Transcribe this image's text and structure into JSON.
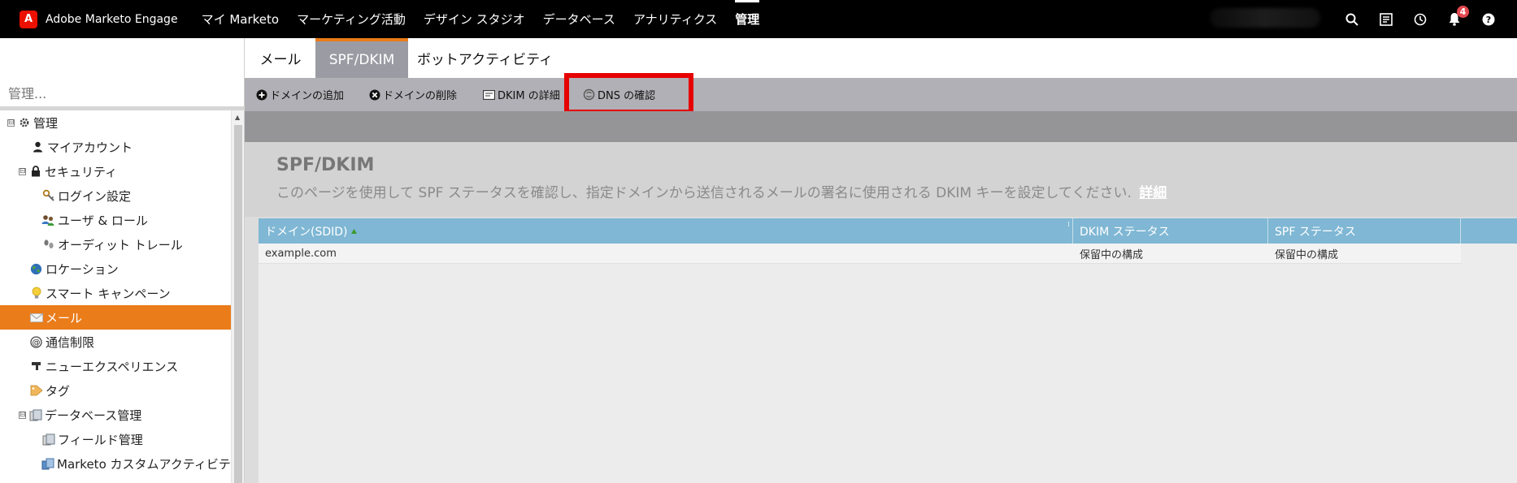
{
  "app": {
    "logo_letter": "A",
    "name": "Adobe Marketo Engage"
  },
  "topnav": {
    "items": [
      {
        "label": "マイ Marketo"
      },
      {
        "label": "マーケティング活動"
      },
      {
        "label": "デザイン スタジオ"
      },
      {
        "label": "データベース"
      },
      {
        "label": "アナリティクス"
      },
      {
        "label": "管理"
      }
    ],
    "notification_count": "4"
  },
  "sidebar": {
    "search_placeholder": "管理...",
    "tree": [
      {
        "label": "管理",
        "expander": "⊟"
      },
      {
        "label": "マイアカウント"
      },
      {
        "label": "セキュリティ",
        "expander": "⊟"
      },
      {
        "label": "ログイン設定"
      },
      {
        "label": "ユーザ & ロール"
      },
      {
        "label": "オーディット トレール"
      },
      {
        "label": "ロケーション"
      },
      {
        "label": "スマート キャンペーン"
      },
      {
        "label": "メール",
        "selected": true
      },
      {
        "label": "通信制限"
      },
      {
        "label": "ニューエクスペリエンス"
      },
      {
        "label": "タグ"
      },
      {
        "label": "データベース管理",
        "expander": "⊟"
      },
      {
        "label": "フィールド管理"
      },
      {
        "label": "Marketo カスタムアクティビティ"
      }
    ]
  },
  "tabs": [
    {
      "label": "メール"
    },
    {
      "label": "SPF/DKIM",
      "active": true
    },
    {
      "label": "ボットアクティビティ"
    }
  ],
  "toolbar": {
    "add_domain": "ドメインの追加",
    "delete_domain": "ドメインの削除",
    "dkim_details": "DKIM の詳細",
    "dns_check": "DNS の確認"
  },
  "page": {
    "title": "SPF/DKIM",
    "description": "このページを使用して SPF ステータスを確認し、指定ドメインから送信されるメールの署名に使用される DKIM キーを設定してください.",
    "link": "詳細"
  },
  "grid": {
    "columns": [
      "ドメイン(SDID)",
      "DKIM ステータス",
      "SPF ステータス"
    ],
    "rows": [
      [
        "example.com",
        "保留中の構成",
        "保留中の構成"
      ]
    ]
  },
  "colors": {
    "accent": "#ea7c1a",
    "header_blue": "#7fb7d4",
    "highlight": "#e60000"
  }
}
